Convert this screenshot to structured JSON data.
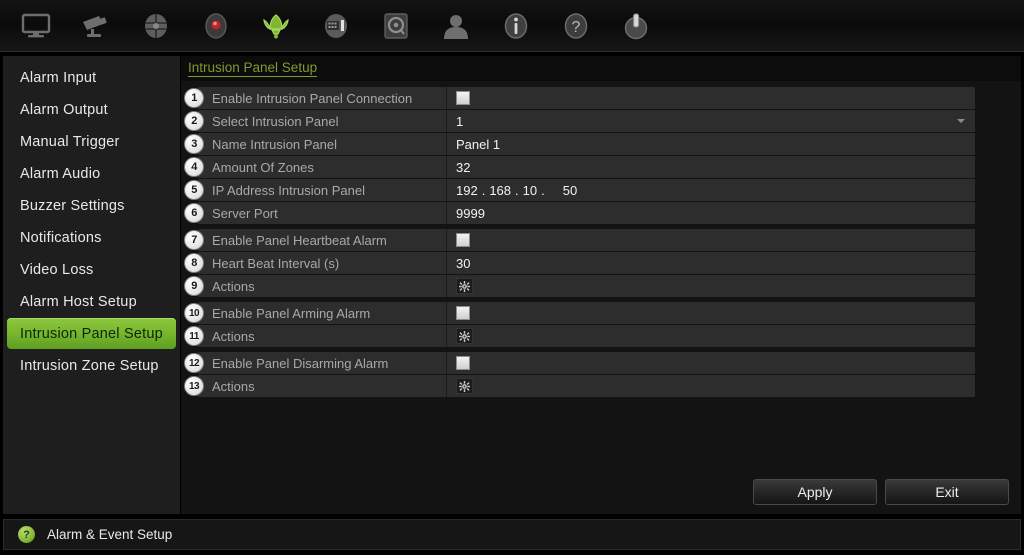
{
  "toolbar": {
    "items": [
      {
        "name": "display-icon",
        "label": "Display"
      },
      {
        "name": "camera-icon",
        "label": "Camera"
      },
      {
        "name": "network-icon",
        "label": "Network"
      },
      {
        "name": "record-icon",
        "label": "Record"
      },
      {
        "name": "alarm-bell-icon",
        "label": "Alarm",
        "active": true,
        "color": "#8dc63f"
      },
      {
        "name": "device-settings-icon",
        "label": "Device Settings"
      },
      {
        "name": "hdd-icon",
        "label": "HDD"
      },
      {
        "name": "user-icon",
        "label": "User"
      },
      {
        "name": "info-icon",
        "label": "Info"
      },
      {
        "name": "help-icon",
        "label": "Help"
      },
      {
        "name": "power-icon",
        "label": "Shutdown"
      }
    ]
  },
  "sidebar": {
    "items": [
      {
        "label": "Alarm Input",
        "active": false
      },
      {
        "label": "Alarm Output",
        "active": false
      },
      {
        "label": "Manual Trigger",
        "active": false
      },
      {
        "label": "Alarm Audio",
        "active": false
      },
      {
        "label": "Buzzer Settings",
        "active": false
      },
      {
        "label": "Notifications",
        "active": false
      },
      {
        "label": "Video Loss",
        "active": false
      },
      {
        "label": "Alarm Host Setup",
        "active": false
      },
      {
        "label": "Intrusion Panel Setup",
        "active": true
      },
      {
        "label": "Intrusion Zone Setup",
        "active": false
      }
    ]
  },
  "content": {
    "page_title": "Intrusion Panel Setup",
    "groups": [
      {
        "rows": [
          {
            "num": "1",
            "label": "Enable Intrusion Panel Connection",
            "type": "checkbox",
            "checked": false
          },
          {
            "num": "2",
            "label": "Select Intrusion Panel",
            "type": "dropdown",
            "value": "1"
          },
          {
            "num": "3",
            "label": "Name Intrusion Panel",
            "type": "text",
            "value": "Panel 1"
          },
          {
            "num": "4",
            "label": "Amount Of Zones",
            "type": "text",
            "value": "32"
          },
          {
            "num": "5",
            "label": "IP Address Intrusion Panel",
            "type": "ip",
            "value": "192 . 168 . 10 .  50",
            "octets": [
              "192",
              "168",
              "10",
              "50"
            ]
          },
          {
            "num": "6",
            "label": "Server Port",
            "type": "text",
            "value": "9999"
          }
        ]
      },
      {
        "rows": [
          {
            "num": "7",
            "label": "Enable Panel Heartbeat Alarm",
            "type": "checkbox",
            "checked": false
          },
          {
            "num": "8",
            "label": "Heart Beat Interval (s)",
            "type": "text",
            "value": "30"
          },
          {
            "num": "9",
            "label": "Actions",
            "type": "gear"
          }
        ]
      },
      {
        "rows": [
          {
            "num": "10",
            "label": "Enable Panel Arming Alarm",
            "type": "checkbox",
            "checked": false
          },
          {
            "num": "11",
            "label": "Actions",
            "type": "gear"
          }
        ]
      },
      {
        "rows": [
          {
            "num": "12",
            "label": "Enable Panel Disarming Alarm",
            "type": "checkbox",
            "checked": false
          },
          {
            "num": "13",
            "label": "Actions",
            "type": "gear"
          }
        ]
      }
    ]
  },
  "buttons": {
    "apply": "Apply",
    "exit": "Exit"
  },
  "statusbar": {
    "icon": "help-circle-icon",
    "icon_glyph": "?",
    "text": "Alarm & Event Setup"
  },
  "colors": {
    "accent_green": "#8dc63f",
    "title_green": "#7d9c2e",
    "row_bg": "#2d2d2d",
    "panel_bg": "#131313",
    "sidebar_bg": "#1e1e1e"
  }
}
